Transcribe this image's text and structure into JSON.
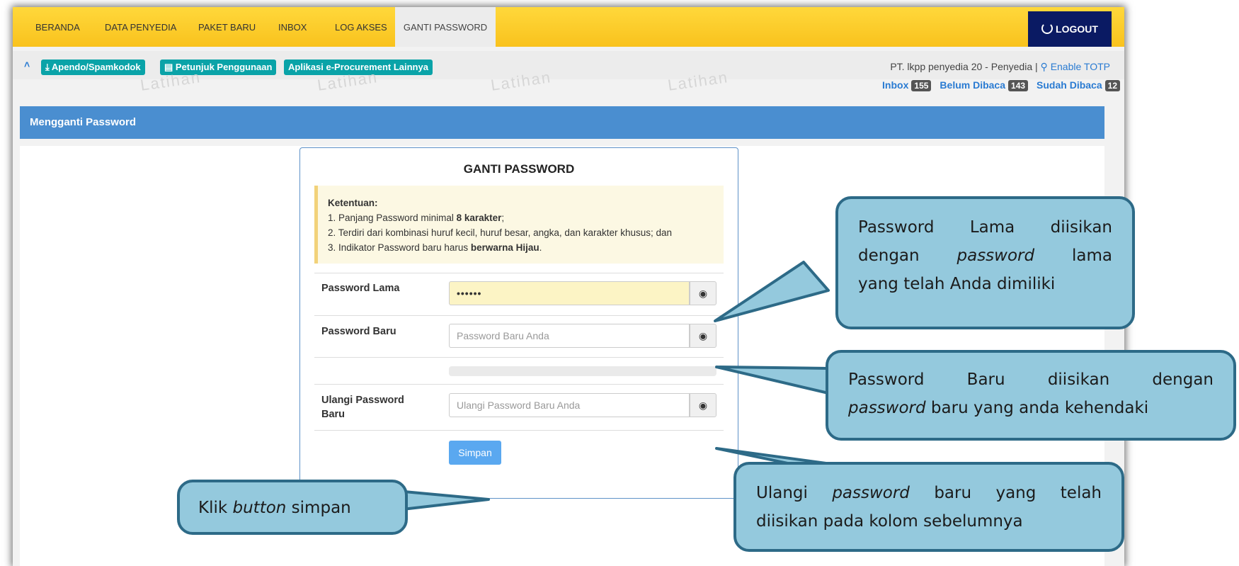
{
  "nav": {
    "items": [
      "BERANDA",
      "DATA PENYEDIA",
      "PAKET BARU",
      "INBOX",
      "LOG AKSES",
      "GANTI PASSWORD"
    ],
    "active_index": 5,
    "logout": "LOGOUT"
  },
  "toolbar": {
    "apendo": "Apendo/Spamkodok",
    "petunjuk": "Petunjuk Penggunaan",
    "aplikasi": "Aplikasi e-Procurement Lainnya"
  },
  "watermark": "Latihan",
  "user": {
    "info": "PT. lkpp penyedia 20 - Penyedia | ",
    "totp": "Enable TOTP"
  },
  "inbox": {
    "inbox_label": "Inbox",
    "inbox_count": "155",
    "belum_label": "Belum Dibaca",
    "belum_count": "143",
    "sudah_label": "Sudah Dibaca",
    "sudah_count": "12"
  },
  "page": {
    "heading": "Mengganti Password"
  },
  "form": {
    "title": "GANTI PASSWORD",
    "rules_heading": "Ketentuan:",
    "rule1_pre": "1. Panjang Password minimal ",
    "rule1_bold": "8 karakter",
    "rule1_post": ";",
    "rule2": "2. Terdiri dari kombinasi huruf kecil, huruf besar, angka, dan karakter khusus; dan",
    "rule3_pre": "3. Indikator Password baru harus ",
    "rule3_bold": "berwarna Hijau",
    "rule3_post": ".",
    "old_label": "Password Lama",
    "old_value": "••••••",
    "new_label": "Password Baru",
    "new_placeholder": "Password Baru Anda",
    "repeat_label_1": "Ulangi Password",
    "repeat_label_2": "Baru",
    "repeat_placeholder": "Ulangi Password Baru Anda",
    "save": "Simpan"
  },
  "callouts": {
    "old_1": "Password Lama diisikan",
    "old_2_pre": "dengan ",
    "old_2_it": "password",
    "old_2_post": " lama",
    "old_3": "yang telah Anda dimiliki",
    "new_1": "Password Baru diisikan dengan",
    "new_2_it": "password",
    "new_2_post": " baru yang anda kehendaki",
    "repeat_1_pre": "Ulangi ",
    "repeat_1_it": "password",
    "repeat_1_post": " baru yang telah",
    "repeat_2": "diisikan pada kolom sebelumnya",
    "save_pre": "Klik ",
    "save_it": "button",
    "save_post": " simpan"
  },
  "colors": {
    "nav": "#f9c21d",
    "header": "#4a8ed0",
    "callout_fill": "#94c9dd",
    "callout_border": "#2d6a87"
  }
}
